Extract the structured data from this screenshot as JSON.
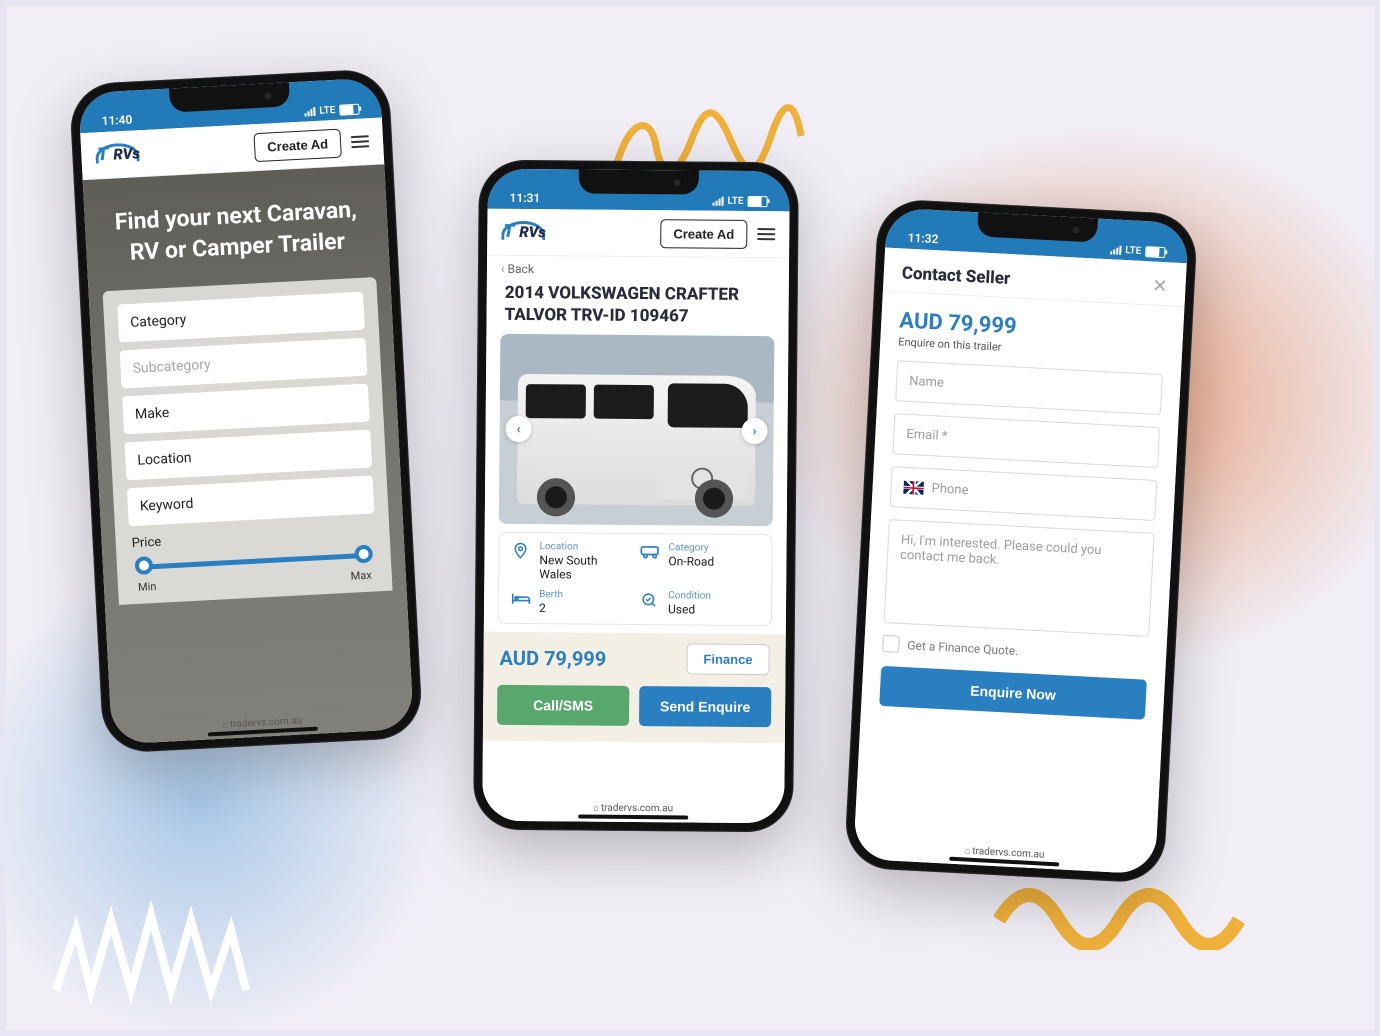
{
  "brand": {
    "logo_t": "T",
    "logo_rvs": "RVs"
  },
  "header": {
    "create_ad": "Create Ad"
  },
  "status": {
    "p1_time": "11:40",
    "p2_time": "11:31",
    "p3_time": "11:32",
    "lte": "LTE"
  },
  "url": "tradervs.com.au",
  "search": {
    "heading": "Find your next Caravan, RV or Camper Trailer",
    "fields": {
      "category": "Category",
      "subcategory": "Subcategory",
      "make": "Make",
      "location": "Location",
      "keyword": "Keyword"
    },
    "price_label": "Price",
    "price_min": "Min",
    "price_max": "Max"
  },
  "listing": {
    "back": "Back",
    "title": "2014 VOLKSWAGEN CRAFTER TALVOR TRV-ID 109467",
    "meta": {
      "location_label": "Location",
      "location_value": "New South Wales",
      "category_label": "Category",
      "category_value": "On-Road",
      "berth_label": "Berth",
      "berth_value": "2",
      "condition_label": "Condition",
      "condition_value": "Used"
    },
    "price": "AUD 79,999",
    "finance": "Finance",
    "call": "Call/SMS",
    "send_enquire": "Send Enquire"
  },
  "contact": {
    "heading": "Contact Seller",
    "price": "AUD 79,999",
    "sub": "Enquire on this trailer",
    "name_ph": "Name",
    "email_ph": "Email *",
    "phone_ph": "Phone",
    "msg_ph": "Hi, I'm interested. Please could you contact me back.",
    "finance_chk": "Get a Finance Quote.",
    "submit": "Enquire Now"
  }
}
